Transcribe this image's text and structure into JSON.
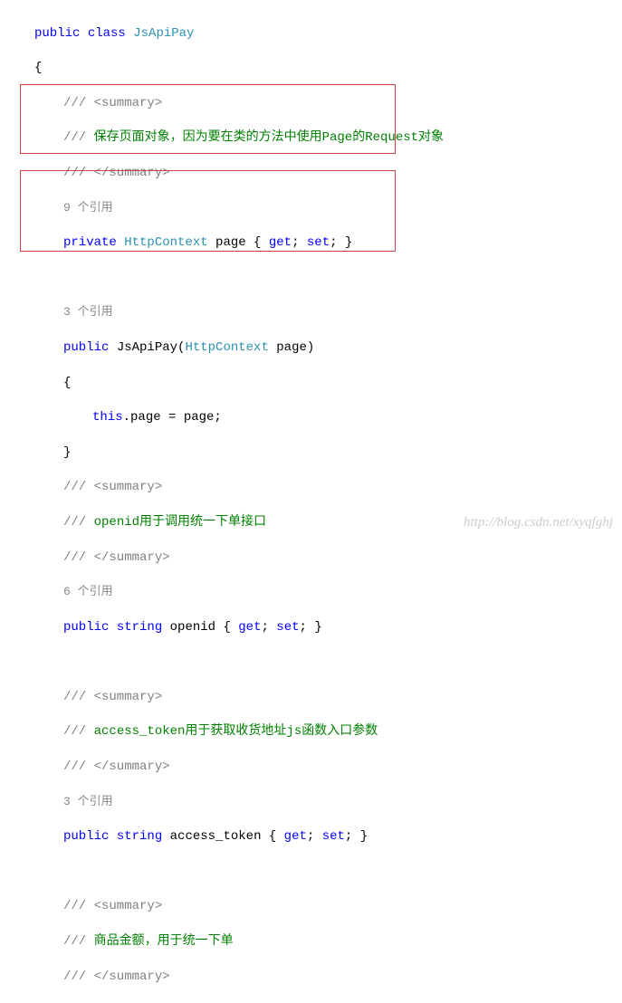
{
  "code": {
    "l1_public": "public",
    "l1_class": "class",
    "l1_name": "JsApiPay",
    "l2_brace": "{",
    "l3_sum": "/// <summary>",
    "l4_pre": "/// ",
    "l4_txt": "保存页面对象，因为要在类的方法中使用Page的Request对象",
    "l5_sum": "/// </summary>",
    "l6_refs": "9 个引用",
    "l7_private": "private",
    "l7_type": "HttpContext",
    "l7_name": " page { ",
    "l7_get": "get",
    "l7_sep": "; ",
    "l7_set": "set",
    "l7_end": "; }",
    "l8_empty": "",
    "l9_refs": "3 个引用",
    "l10_public": "public",
    "l10_name": " JsApiPay(",
    "l10_type": "HttpContext",
    "l10_param": " page)",
    "l11_brace": "{",
    "l12_this": "this",
    "l12_rest": ".page = page;",
    "l13_brace": "}",
    "l14_sum": "/// <summary>",
    "l15_pre": "/// ",
    "l15_txt": "openid用于调用统一下单接口",
    "l16_sum": "/// </summary>",
    "l17_refs": "6 个引用",
    "l18_public": "public",
    "l18_string": "string",
    "l18_name": " openid { ",
    "l18_get": "get",
    "l18_set": "set",
    "l19_empty": "",
    "l20_sum": "/// <summary>",
    "l21_pre": "/// ",
    "l21_txt": "access_token用于获取收货地址js函数入口参数",
    "l22_sum": "/// </summary>",
    "l23_refs": "3 个引用",
    "l24_public": "public",
    "l24_string": "string",
    "l24_name": " access_token { ",
    "l24_get": "get",
    "l24_set": "set",
    "l25_empty": "",
    "l26_sum": "/// <summary>",
    "l27_pre": "/// ",
    "l27_txt": "商品金额，用于统一下单",
    "l28_sum": "/// </summary>"
  },
  "watermark": "http://blog.csdn.net/xyqfghj"
}
